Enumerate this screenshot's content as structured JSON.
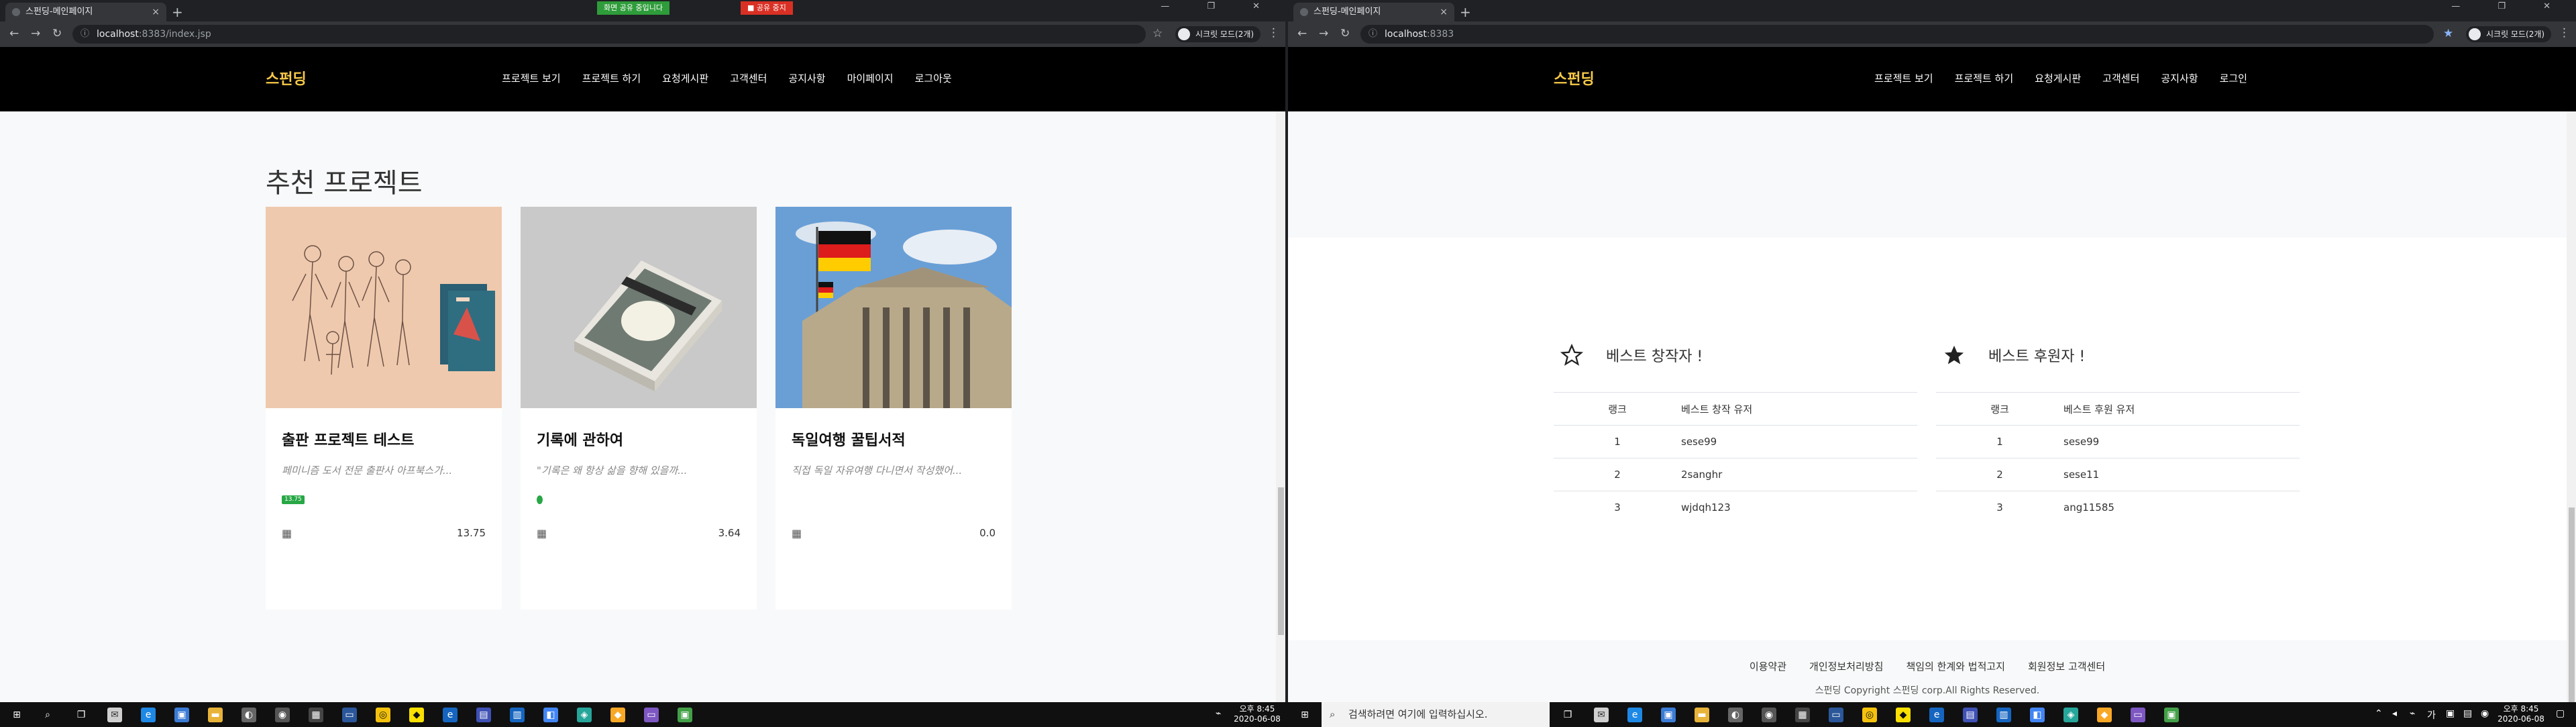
{
  "browser_left": {
    "tab_title": "스펀딩-메인페이지",
    "tab_close": "×",
    "new_tab": "+",
    "window_controls": "— ❐ ✕",
    "share_notice": "화면 공유 중입니다",
    "share_stop": "■ 공유 중지",
    "url_host": "localhost",
    "url_path": ":8383/index.jsp",
    "profile_label": "시크릿 모드(2개)"
  },
  "browser_right": {
    "tab_title": "스펀딩-메인페이지",
    "tab_close": "×",
    "new_tab": "+",
    "window_controls": "— ❐ ✕",
    "url_host": "localhost",
    "url_path": ":8383",
    "profile_label": "시크릿 모드(2개)"
  },
  "site_left": {
    "brand": "스펀딩",
    "menu": [
      "프로젝트 보기",
      "프로젝트 하기",
      "요청게시판",
      "고객센터",
      "공지사항",
      "마이페이지",
      "로그아웃"
    ],
    "section_title": "추천 프로젝트",
    "cards": [
      {
        "title": "출판 프로젝트 테스트",
        "desc": "페미니즘 도서 전문 출판사 아프북스가...",
        "badge": "13.75",
        "rating": "13.75",
        "calendar_icon": "calendar-icon"
      },
      {
        "title": "기록에 관하여",
        "desc": "\"기록은 왜 항상 삶을 향해 있을까...",
        "badge": "0",
        "rating": "3.64",
        "calendar_icon": "calendar-icon"
      },
      {
        "title": "독일여행 꿀팁서적",
        "desc": "직접 독일 자유여행 다니면서 작성했어...",
        "badge": "",
        "rating": "0.0",
        "calendar_icon": "calendar-icon"
      }
    ]
  },
  "site_right": {
    "brand": "스펀딩",
    "menu": [
      "프로젝트 보기",
      "프로젝트 하기",
      "요청게시판",
      "고객센터",
      "공지사항",
      "로그인"
    ],
    "best_creators": {
      "title": "베스트 창작자 !",
      "icon": "star-outline-icon",
      "headers": [
        "랭크",
        "베스트 창작 유저"
      ],
      "rows": [
        [
          "1",
          "sese99"
        ],
        [
          "2",
          "2sanghr"
        ],
        [
          "3",
          "wjdqh123"
        ]
      ]
    },
    "best_sponsors": {
      "title": "베스트 후원자 !",
      "icon": "star-filled-icon",
      "headers": [
        "랭크",
        "베스트 후원 유저"
      ],
      "rows": [
        [
          "1",
          "sese99"
        ],
        [
          "2",
          "sese11"
        ],
        [
          "3",
          "ang11585"
        ]
      ]
    },
    "footer_links": [
      "이용약관",
      "개인정보처리방침",
      "책임의 한계와 법적고지",
      "회원정보 고객센터"
    ],
    "copyright": "스펀딩 Copyright 스펀딩 corp.All Rights Reserved."
  },
  "taskbar": {
    "search_placeholder": "검색하려면 여기에 입력하십시오.",
    "left_time": "오후 8:45",
    "left_date": "2020-06-08",
    "right_time": "오후 8:45",
    "right_date": "2020-06-08"
  },
  "colors": {
    "brand": "#f7c948",
    "nav_bg": "#000000",
    "badge_green": "#28a745"
  }
}
